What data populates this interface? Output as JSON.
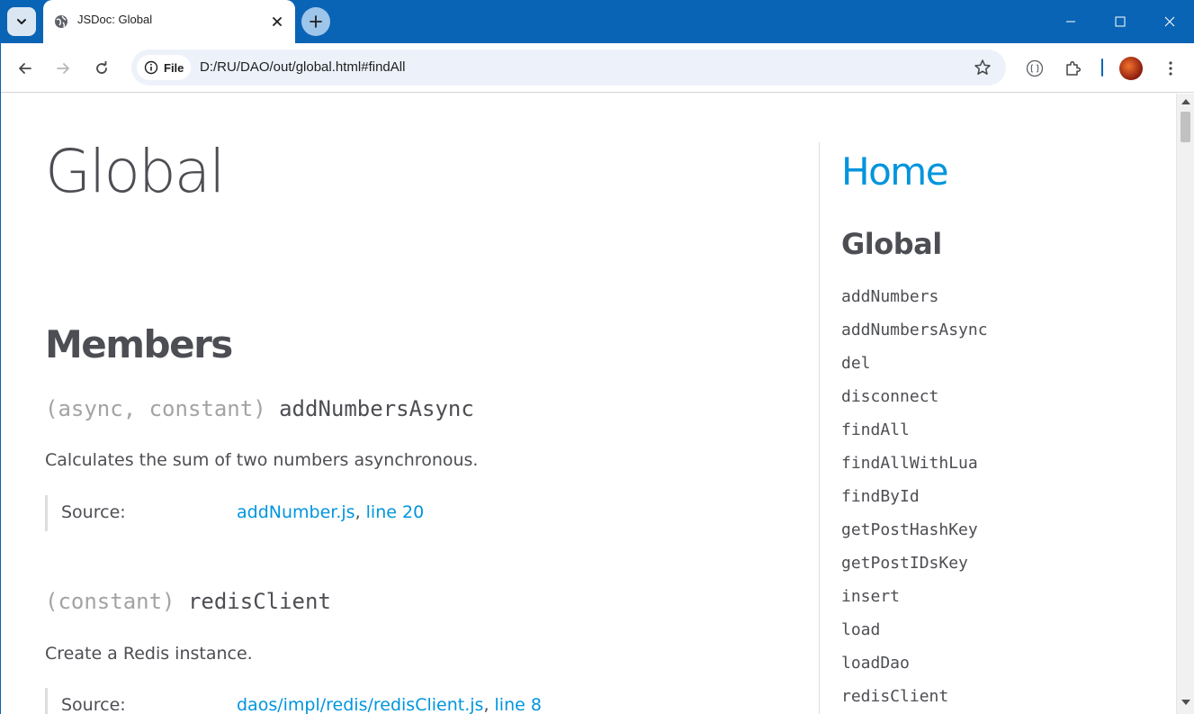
{
  "browser": {
    "tab": {
      "title": "JSDoc: Global"
    },
    "address_bar": {
      "chip_label": "File",
      "url": "D:/RU/DAO/out/global.html#findAll"
    }
  },
  "page": {
    "title": "Global",
    "members_heading": "Members",
    "members": [
      {
        "attribs": "(async, constant)",
        "name": "addNumbersAsync",
        "description": "Calculates the sum of two numbers asynchronous.",
        "source_label": "Source:",
        "source_file": "addNumber.js",
        "source_separator": ",",
        "source_line": "line 20"
      },
      {
        "attribs": "(constant)",
        "name": "redisClient",
        "description": "Create a Redis instance.",
        "source_label": "Source:",
        "source_file": "daos/impl/redis/redisClient.js",
        "source_separator": ",",
        "source_line": "line 8"
      }
    ]
  },
  "nav": {
    "home": "Home",
    "section_heading": "Global",
    "items": [
      "addNumbers",
      "addNumbersAsync",
      "del",
      "disconnect",
      "findAll",
      "findAllWithLua",
      "findById",
      "getPostHashKey",
      "getPostIDsKey",
      "insert",
      "load",
      "loadDao",
      "redisClient"
    ]
  },
  "colors": {
    "titlebar": "#0a64b5",
    "link": "#0095dd",
    "text": "#4d4e53",
    "attribs": "#a3a3a3"
  },
  "icons": {
    "tab_menu": "chevron-down-icon",
    "favicon": "globe-icon",
    "tab_close": "close-icon",
    "new_tab": "plus-icon",
    "minimize": "minimize-icon",
    "maximize": "maximize-icon",
    "close": "close-icon",
    "back": "arrow-left-icon",
    "forward": "arrow-right-icon",
    "reload": "reload-icon",
    "info": "info-icon",
    "bookmark": "star-icon",
    "extension_1": "code-braces-icon",
    "extension_2": "puzzle-icon",
    "menu": "kebab-menu-icon"
  }
}
